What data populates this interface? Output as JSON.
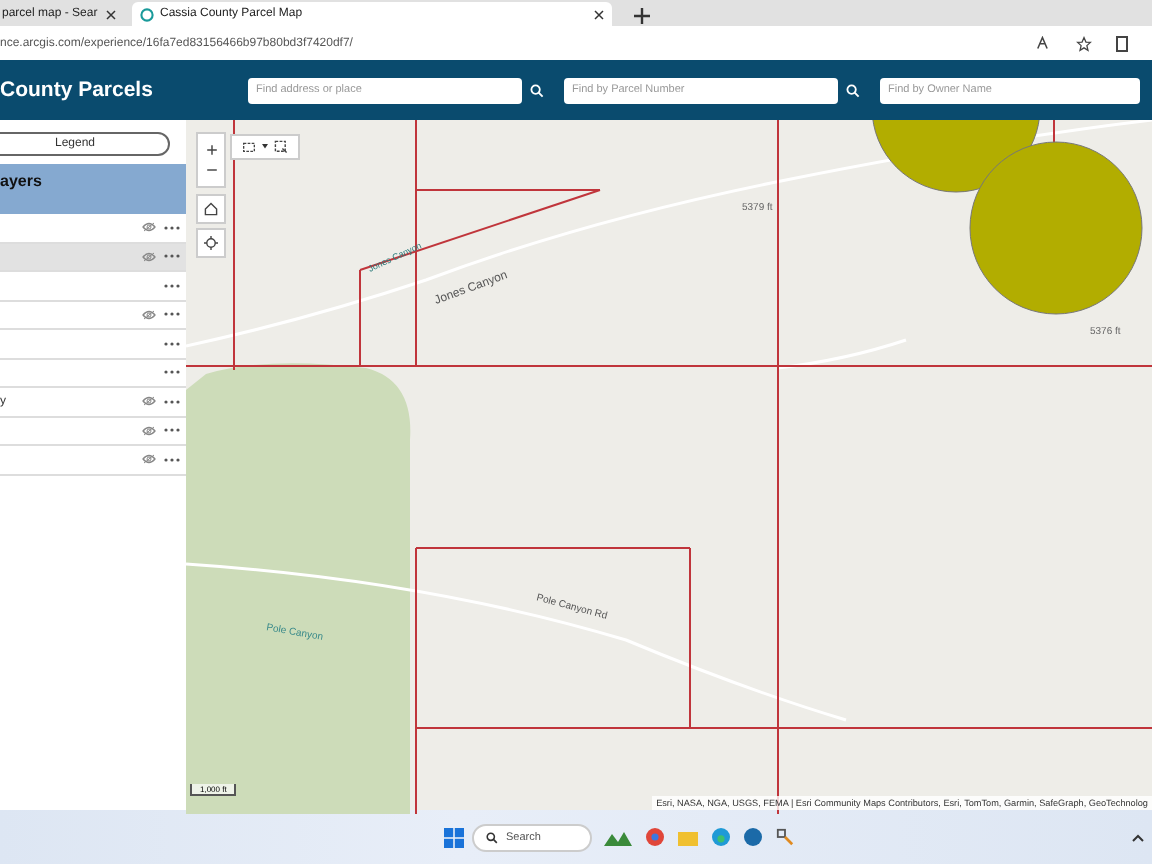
{
  "browser": {
    "tabs": [
      {
        "label": "parcel map - Sear",
        "selected": false
      },
      {
        "label": "Cassia County Parcel Map",
        "selected": true
      }
    ],
    "url": "nce.arcgis.com/experience/16fa7ed83156466b97b80bd3f7420df7/"
  },
  "header": {
    "title": "County Parcels",
    "searches": [
      {
        "placeholder": "Find address or place"
      },
      {
        "placeholder": "Find by Parcel Number"
      },
      {
        "placeholder": "Find by Owner Name"
      }
    ]
  },
  "sidebar": {
    "legend_button": "Legend",
    "panel_title": "ayers",
    "layers": [
      {
        "visible_toggle": true,
        "selected": false
      },
      {
        "visible_toggle": true,
        "selected": true
      },
      {
        "visible_toggle": false,
        "selected": false
      },
      {
        "visible_toggle": true,
        "selected": false
      },
      {
        "visible_toggle": false,
        "selected": false
      },
      {
        "visible_toggle": false,
        "selected": false
      },
      {
        "label": "y",
        "visible_toggle": true,
        "selected": false
      },
      {
        "visible_toggle": true,
        "selected": false
      },
      {
        "visible_toggle": true,
        "selected": false
      }
    ]
  },
  "map": {
    "labels": [
      "Jones Canyon",
      "Jones Canyon",
      "5379 ft",
      "5376 ft",
      "Pole Canyon",
      "Pole Canyon Rd"
    ],
    "scale": "1,000 ft",
    "attribution": "Esri, NASA, NGA, USGS, FEMA | Esri Community Maps Contributors, Esri, TomTom, Garmin, SafeGraph, GeoTechnolog"
  },
  "taskbar": {
    "search_placeholder": "Search"
  }
}
